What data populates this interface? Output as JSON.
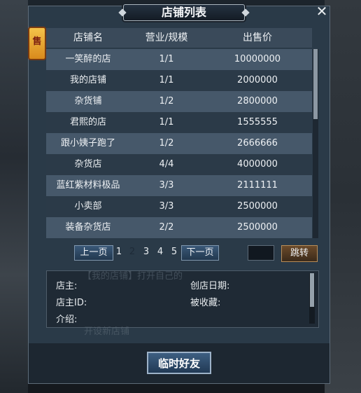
{
  "window": {
    "title": "店铺列表",
    "close_icon": "close-icon",
    "lantern_char": "售"
  },
  "table": {
    "headers": [
      "店铺名",
      "营业/规模",
      "出售价"
    ],
    "rows": [
      {
        "name": "一笑醉的店",
        "scale": "1/1",
        "price": "10000000"
      },
      {
        "name": "我的店铺",
        "scale": "1/1",
        "price": "2000000"
      },
      {
        "name": "杂货铺",
        "scale": "1/2",
        "price": "2800000"
      },
      {
        "name": "君熙的店",
        "scale": "1/1",
        "price": "1555555"
      },
      {
        "name": "跟小姨子跑了",
        "scale": "1/2",
        "price": "2666666"
      },
      {
        "name": "杂货店",
        "scale": "4/4",
        "price": "4000000"
      },
      {
        "name": "蓝红紫材料极品",
        "scale": "3/3",
        "price": "2111111"
      },
      {
        "name": "小卖部",
        "scale": "3/3",
        "price": "2500000"
      },
      {
        "name": "装备杂货店",
        "scale": "2/2",
        "price": "2500000"
      }
    ]
  },
  "pager": {
    "prev_label": "上一页",
    "next_label": "下一页",
    "pages": [
      "1",
      "2",
      "3",
      "4",
      "5"
    ],
    "current_page": "2",
    "jump_label": "跳转",
    "jump_value": ""
  },
  "info": {
    "owner_label": "店主:",
    "created_label": "创店日期:",
    "owner_id_label": "店主ID:",
    "favorited_label": "被收藏:",
    "intro_label": "介绍:"
  },
  "bottom": {
    "friend_button": "临时好友"
  },
  "background_text": {
    "line1": "【我的店铺】打开自己的",
    "line2": "开设新店铺"
  }
}
